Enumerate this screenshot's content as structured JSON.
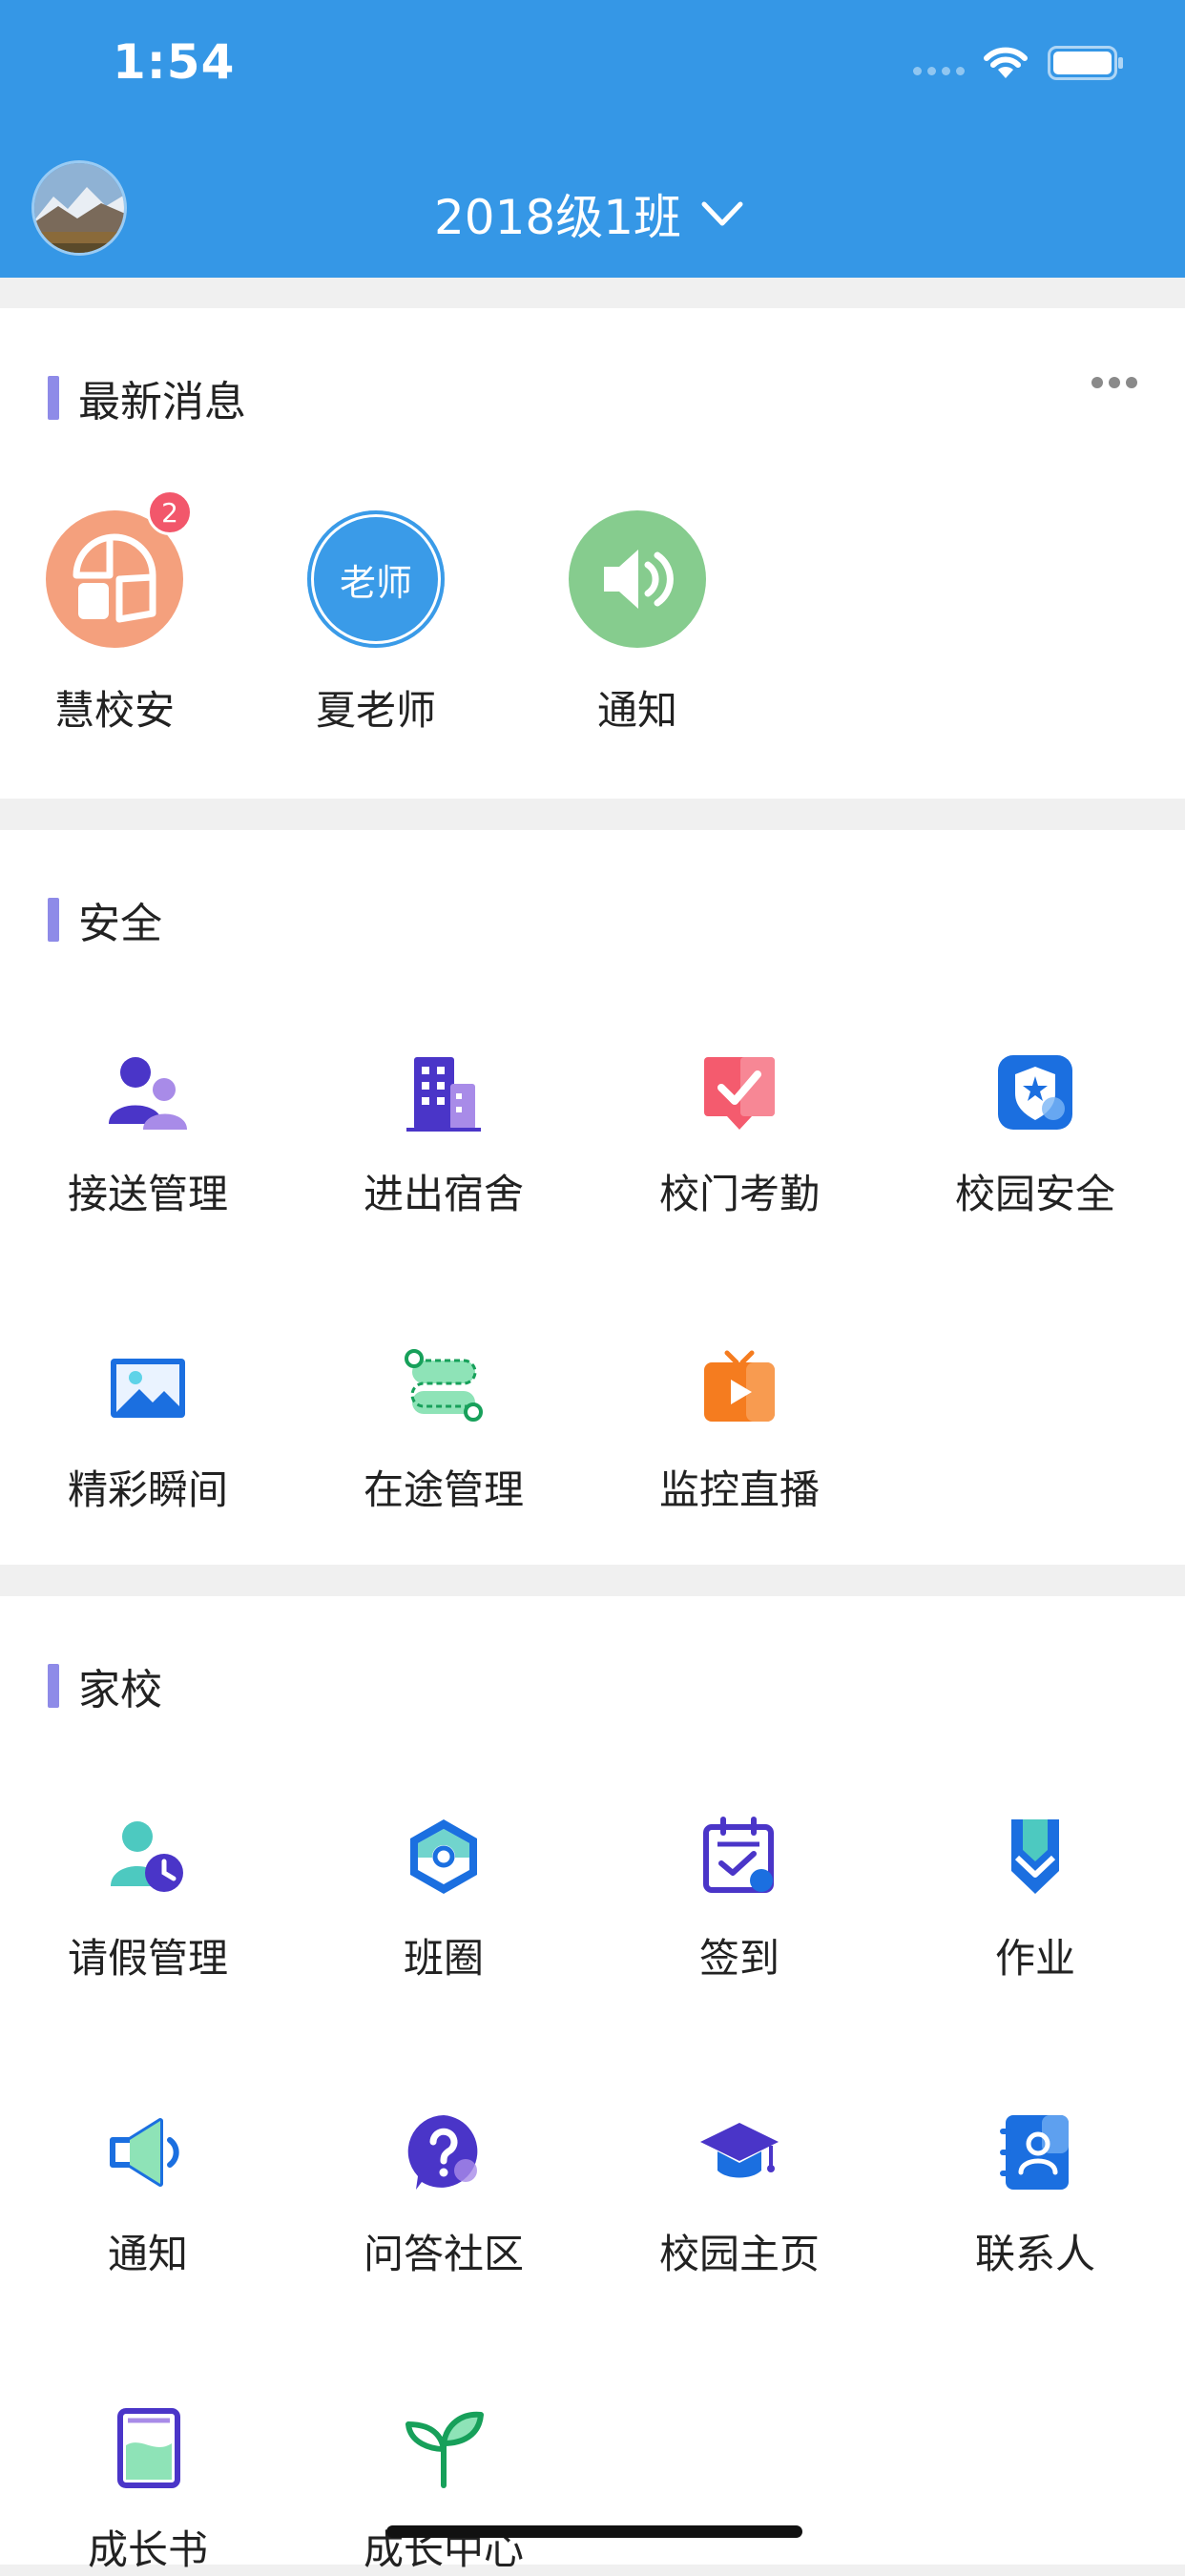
{
  "status_bar": {
    "time": "1:54"
  },
  "header": {
    "class_name": "2018级1班"
  },
  "news": {
    "title": "最新消息",
    "items": [
      {
        "label": "慧校安",
        "badge": "2",
        "color": "#f4a07d",
        "icon": "school-shield-icon"
      },
      {
        "label": "夏老师",
        "avatar_text": "老师",
        "color": "#3a9be8",
        "icon": "teacher-avatar"
      },
      {
        "label": "通知",
        "color": "#86cc8e",
        "icon": "speaker-icon"
      }
    ]
  },
  "safety": {
    "title": "安全",
    "items": [
      {
        "label": "接送管理",
        "icon": "pickup-people-icon"
      },
      {
        "label": "进出宿舍",
        "icon": "dormitory-building-icon"
      },
      {
        "label": "校门考勤",
        "icon": "attendance-check-icon"
      },
      {
        "label": "校园安全",
        "icon": "campus-shield-icon"
      },
      {
        "label": "精彩瞬间",
        "icon": "photo-moment-icon"
      },
      {
        "label": "在途管理",
        "icon": "route-tracking-icon"
      },
      {
        "label": "监控直播",
        "icon": "live-tv-icon"
      }
    ]
  },
  "home_school": {
    "title": "家校",
    "items": [
      {
        "label": "请假管理",
        "icon": "leave-clock-icon"
      },
      {
        "label": "班圈",
        "icon": "class-circle-icon"
      },
      {
        "label": "签到",
        "icon": "checkin-calendar-icon"
      },
      {
        "label": "作业",
        "icon": "homework-pen-icon"
      },
      {
        "label": "通知",
        "icon": "megaphone-icon"
      },
      {
        "label": "问答社区",
        "icon": "question-bubble-icon"
      },
      {
        "label": "校园主页",
        "icon": "graduation-cap-icon"
      },
      {
        "label": "联系人",
        "icon": "contact-book-icon"
      },
      {
        "label": "成长书",
        "icon": "growth-book-icon"
      },
      {
        "label": "成长中心",
        "icon": "sprout-icon"
      }
    ]
  },
  "colors": {
    "header_bg": "#3597e6",
    "accent_bar": "#8e8be8",
    "badge": "#f2576b"
  }
}
